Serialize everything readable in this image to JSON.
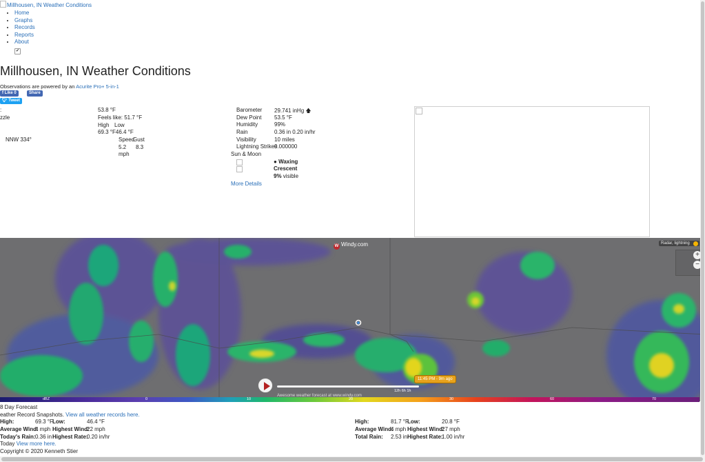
{
  "site": {
    "logo_alt": "Millhousen, IN Weather Conditions",
    "nav": [
      "Home",
      "Graphs",
      "Records",
      "Reports",
      "About"
    ],
    "title": "Millhousen, IN Weather Conditions",
    "powered_prefix": "Observations are powered by an ",
    "powered_link": "Acurite Pro+ 5-in-1"
  },
  "social": {
    "like": "Like 0",
    "share": "Share",
    "tweet": "Tweet"
  },
  "conditions": {
    "left_fragment": ":",
    "condition_fragment": "zzle",
    "wind_dir": "NNW 334°",
    "temp": "53.8 °F",
    "feels_like": "Feels like: 51.7 °F",
    "high_label": "High",
    "low_label": "Low",
    "high_low_values": "69.3 °F46.4 °F",
    "speed_label": "Speed",
    "gust_label": "Gust",
    "speed_value": "5.2",
    "gust_value": "8.3",
    "speed_unit": "mph"
  },
  "details": {
    "barometer_label": "Barometer",
    "barometer_value": "29.741 inHg",
    "dewpoint_label": "Dew Point",
    "dewpoint_value": "53.5 °F",
    "humidity_label": "Humidity",
    "humidity_value": "99%",
    "rain_label": "Rain",
    "rain_value": "0.36 in  0.20 in/hr",
    "visibility_label": "Visibility",
    "visibility_value": "10 miles",
    "lightning_label": "Lightning Strikes",
    "lightning_value": "0.000000",
    "sunmoon_label": "Sun & Moon",
    "moon_phase_line1": "Waxing",
    "moon_phase_line2": "Crescent",
    "moon_visible_pct": "9%",
    "moon_visible_suffix": " visible",
    "more_details": "More Details"
  },
  "map": {
    "brand": "Windy",
    "brand_suffix": ".com",
    "layer_chip": "Radar, lightning",
    "zoom_in": "+",
    "zoom_out": "−",
    "time_badge": "11:45 PM - 9m ago",
    "timeline_marks": "12h   6h   1h",
    "attribution": "Awesome weather forecast at www.windy.com",
    "legend_unit": "dBZ",
    "legend_ticks": [
      "0",
      "10",
      "20",
      "30",
      "50",
      "60",
      "70"
    ]
  },
  "bottom": {
    "forecast_title": "8 Day Forecast",
    "snapshots_prefix": "eather Record Snapshots. ",
    "snapshots_link": "View all weather records here.",
    "left": {
      "high_label": "High:",
      "high_value": "69.3 °F",
      "low_label": "Low:",
      "low_value": "46.4 °F",
      "avgwind_label": "Average Wind:",
      "avgwind_value": "4 mph",
      "hiwind_label": "Highest Wind:",
      "hiwind_value": "22 mph",
      "rain_label": "Today's Rain:",
      "rain_value": "0.36 in",
      "rate_label": "Highest Rate:",
      "rate_value": "0.20 in/hr"
    },
    "right": {
      "high_label": "High:",
      "high_value": "81.7 °F",
      "low_label": "Low:",
      "low_value": "20.8 °F",
      "avgwind_label": "Average Wind:",
      "avgwind_value": "4 mph",
      "hiwind_label": "Highest Wind:",
      "hiwind_value": "27 mph",
      "rain_label": "Total Rain:",
      "rain_value": "2.53 in",
      "rate_label": "Highest Rate:",
      "rate_value": "1.00 in/hr"
    },
    "today_prefix": "Today ",
    "today_link": "View more here.",
    "copyright": "Copyright © 2020 Kenneth Stier"
  },
  "colors": {
    "link": "#2a6fb8",
    "facebook": "#4267b2",
    "twitter": "#1da1f2",
    "map_bg": "#6e6e70",
    "time_badge": "#e7a21c"
  }
}
